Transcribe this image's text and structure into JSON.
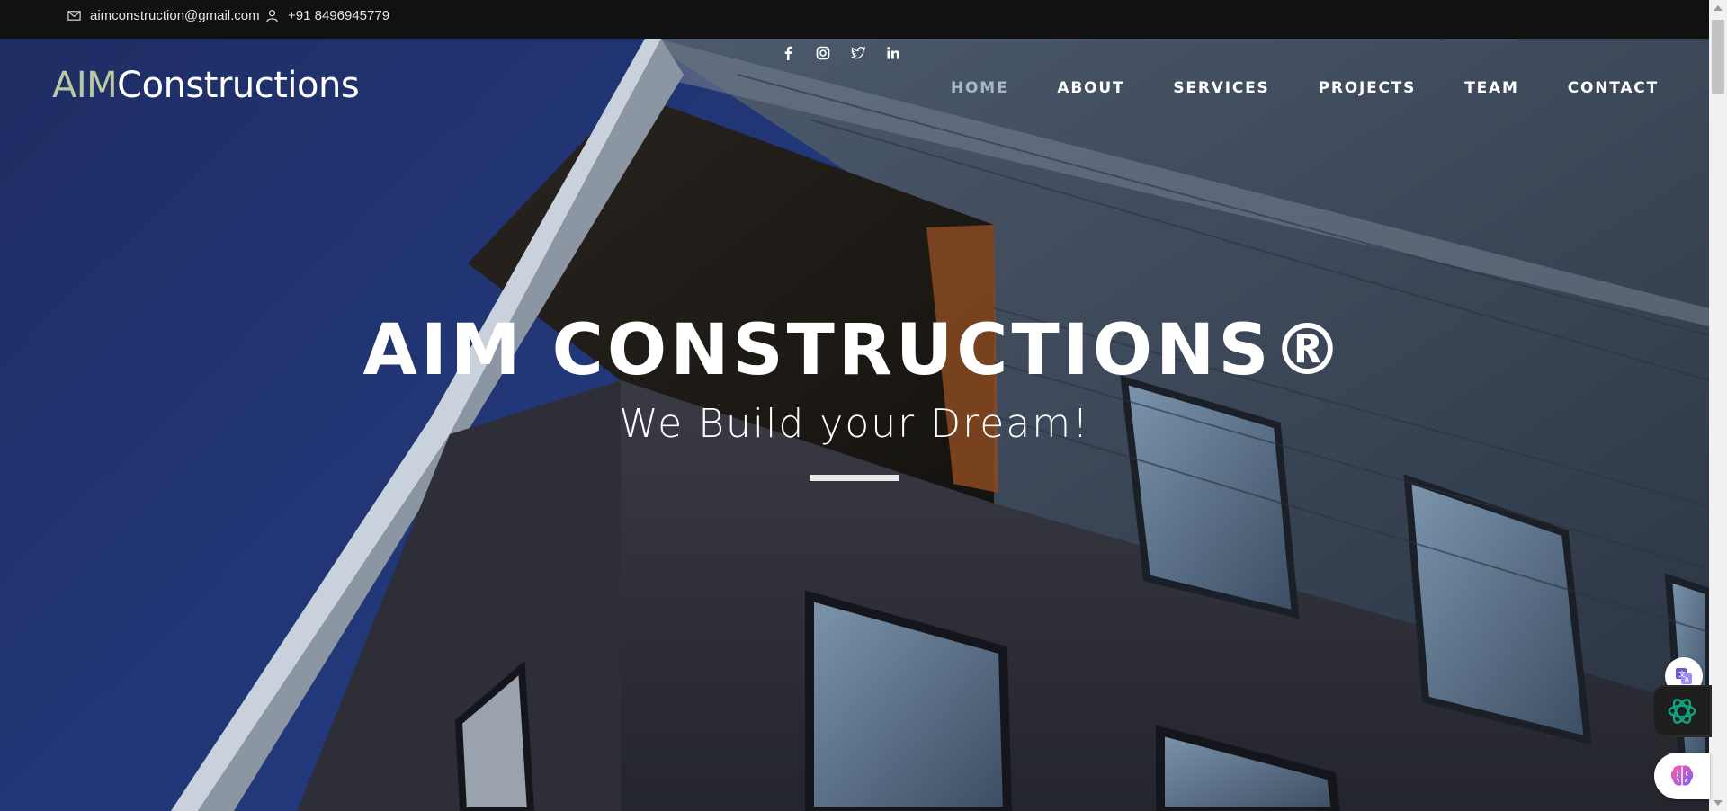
{
  "topbar": {
    "email": "aimconstruction@gmail.com",
    "phone": "+91 8496945779"
  },
  "logo": {
    "prefix": "AIM",
    "rest": "Constructions"
  },
  "social": [
    "facebook-icon",
    "instagram-icon",
    "twitter-icon",
    "linkedin-icon"
  ],
  "nav": {
    "items": [
      "HOME",
      "ABOUT",
      "SERVICES",
      "PROJECTS",
      "TEAM",
      "CONTACT"
    ],
    "active": "HOME"
  },
  "hero": {
    "title": "AIM CONSTRUCTIONS®",
    "tagline": "We Build your Dream!"
  },
  "colors": {
    "sky_blue": "#1f3a85",
    "logo_accent": "#b8c7a4",
    "topbar_bg": "#111111",
    "active_nav": "#a9b6c9"
  }
}
